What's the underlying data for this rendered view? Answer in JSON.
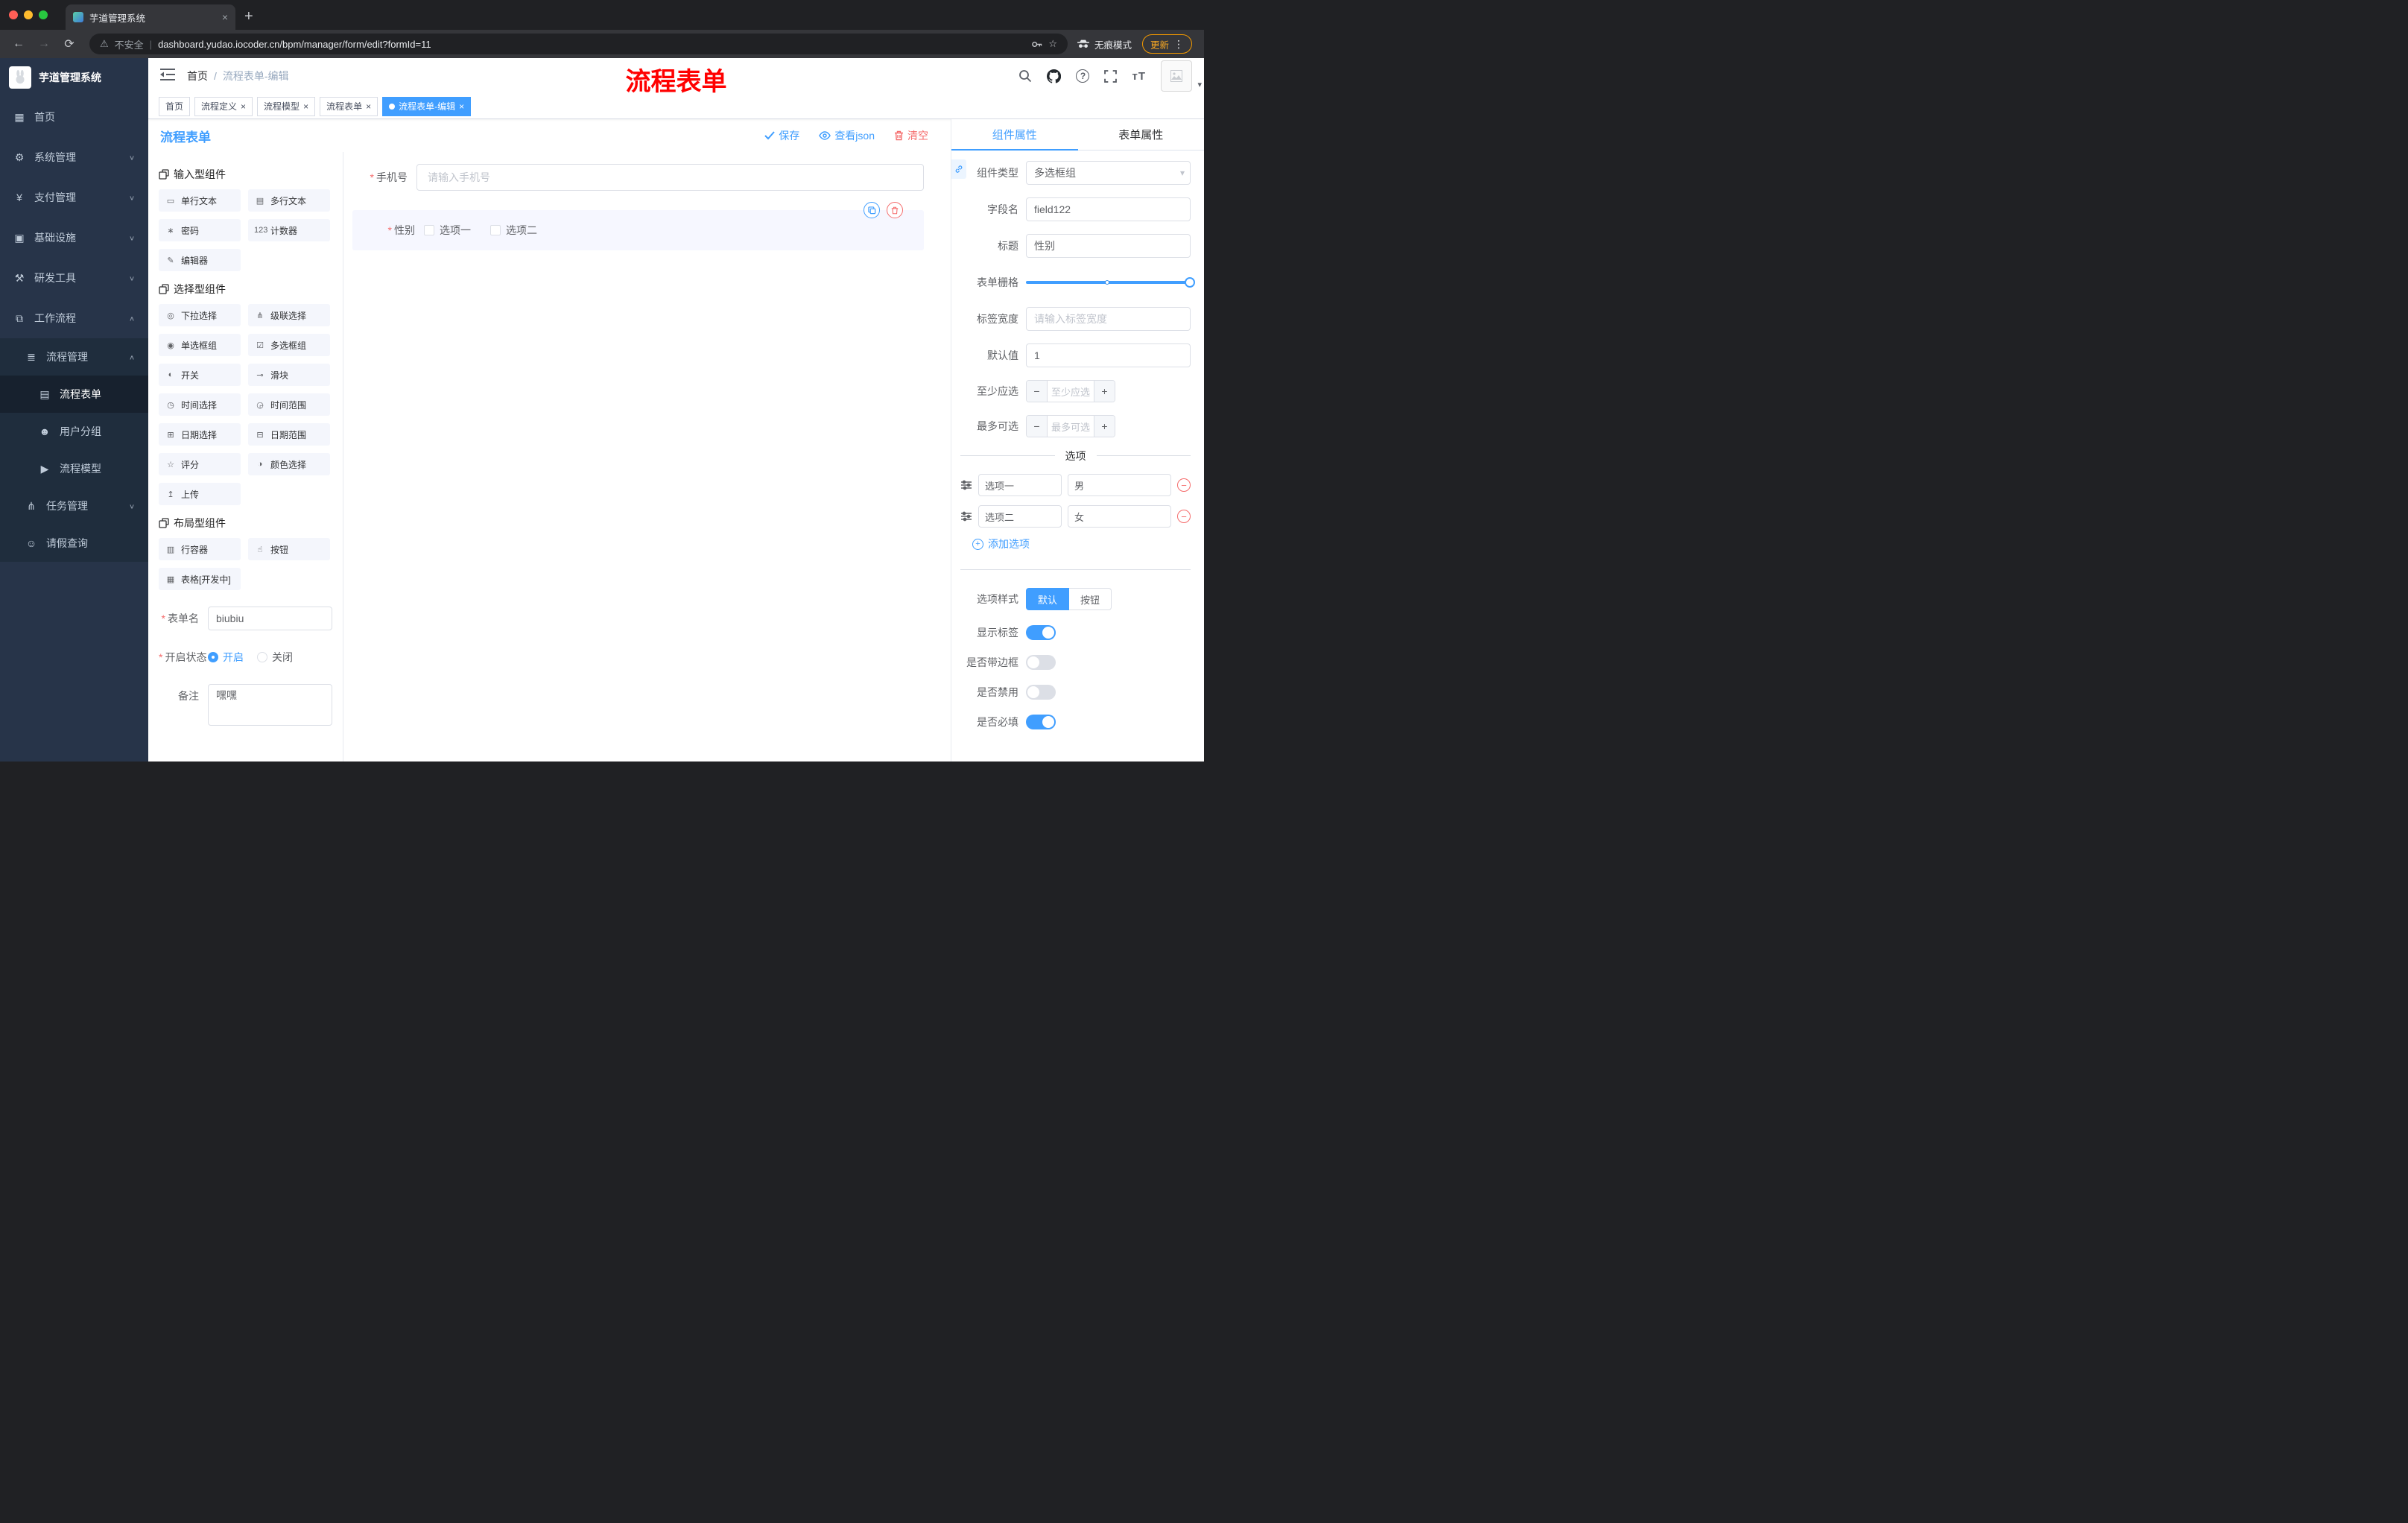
{
  "colors": {
    "accent": "#409eff",
    "danger": "#f56c6c",
    "sidebar": "#273449",
    "update_orange": "#f29900"
  },
  "browser": {
    "tab_title": "芋道管理系统",
    "security": "不安全",
    "url": "dashboard.yudao.iocoder.cn/bpm/manager/form/edit?formId=11",
    "incognito": "无痕模式",
    "update": "更新"
  },
  "sidebar": {
    "logo_title": "芋道管理系统",
    "home": "首页",
    "system": "系统管理",
    "payment": "支付管理",
    "infra": "基础设施",
    "devtools": "研发工具",
    "workflow": "工作流程",
    "process_mgmt": "流程管理",
    "process_form": "流程表单",
    "user_group": "用户分组",
    "process_model": "流程模型",
    "task_mgmt": "任务管理",
    "leave_query": "请假查询"
  },
  "header": {
    "breadcrumb_home": "首页",
    "breadcrumb_sep": "/",
    "breadcrumb_current": "流程表单-编辑",
    "annotation": "流程表单"
  },
  "tags": [
    {
      "label": "首页"
    },
    {
      "label": "流程定义"
    },
    {
      "label": "流程模型"
    },
    {
      "label": "流程表单"
    },
    {
      "label": "流程表单-编辑"
    }
  ],
  "designer": {
    "title": "流程表单",
    "save": "保存",
    "view_json": "查看json",
    "clear": "清空",
    "sections": [
      {
        "title": "输入型组件",
        "items": [
          {
            "icon": "▭",
            "label": "单行文本"
          },
          {
            "icon": "▤",
            "label": "多行文本"
          },
          {
            "icon": "∗",
            "label": "密码"
          },
          {
            "icon": "123",
            "label": "计数器"
          },
          {
            "icon": "✎",
            "label": "编辑器"
          }
        ]
      },
      {
        "title": "选择型组件",
        "items": [
          {
            "icon": "◎",
            "label": "下拉选择"
          },
          {
            "icon": "⋔",
            "label": "级联选择"
          },
          {
            "icon": "◉",
            "label": "单选框组"
          },
          {
            "icon": "☑",
            "label": "多选框组"
          },
          {
            "icon": "◐",
            "label": "开关"
          },
          {
            "icon": "⊸",
            "label": "滑块"
          },
          {
            "icon": "◷",
            "label": "时间选择"
          },
          {
            "icon": "◶",
            "label": "时间范围"
          },
          {
            "icon": "⊞",
            "label": "日期选择"
          },
          {
            "icon": "⊟",
            "label": "日期范围"
          },
          {
            "icon": "☆",
            "label": "评分"
          },
          {
            "icon": "◑",
            "label": "颜色选择"
          },
          {
            "icon": "↥",
            "label": "上传"
          }
        ]
      },
      {
        "title": "布局型组件",
        "items": [
          {
            "icon": "▥",
            "label": "行容器"
          },
          {
            "icon": "☝",
            "label": "按钮"
          },
          {
            "icon": "▦",
            "label": "表格[开发中]"
          }
        ]
      }
    ],
    "meta": {
      "form_name_label": "表单名",
      "form_name_value": "biubiu",
      "status_label": "开启状态",
      "status_on": "开启",
      "status_off": "关闭",
      "remark_label": "备注",
      "remark_value": "嘿嘿"
    },
    "canvas": {
      "phone_label": "手机号",
      "phone_placeholder": "请输入手机号",
      "gender_label": "性别",
      "gender_options": [
        "选项一",
        "选项二"
      ]
    }
  },
  "props": {
    "tab_component": "组件属性",
    "tab_form": "表单属性",
    "component_type_label": "组件类型",
    "component_type_value": "多选框组",
    "field_name_label": "字段名",
    "field_name_value": "field122",
    "title_label": "标题",
    "title_value": "性别",
    "grid_label": "表单栅格",
    "label_width_label": "标签宽度",
    "label_width_placeholder": "请输入标签宽度",
    "default_label": "默认值",
    "default_value": "1",
    "min_label": "至少应选",
    "min_placeholder": "至少应选",
    "max_label": "最多可选",
    "max_placeholder": "最多可选",
    "options_title": "选项",
    "options": [
      {
        "label": "选项一",
        "value": "男"
      },
      {
        "label": "选项二",
        "value": "女"
      }
    ],
    "add_option": "添加选项",
    "style_label": "选项样式",
    "style_default": "默认",
    "style_button": "按钮",
    "show_label": "显示标签",
    "border_label": "是否带边框",
    "disabled_label": "是否禁用",
    "required_label": "是否必填"
  }
}
